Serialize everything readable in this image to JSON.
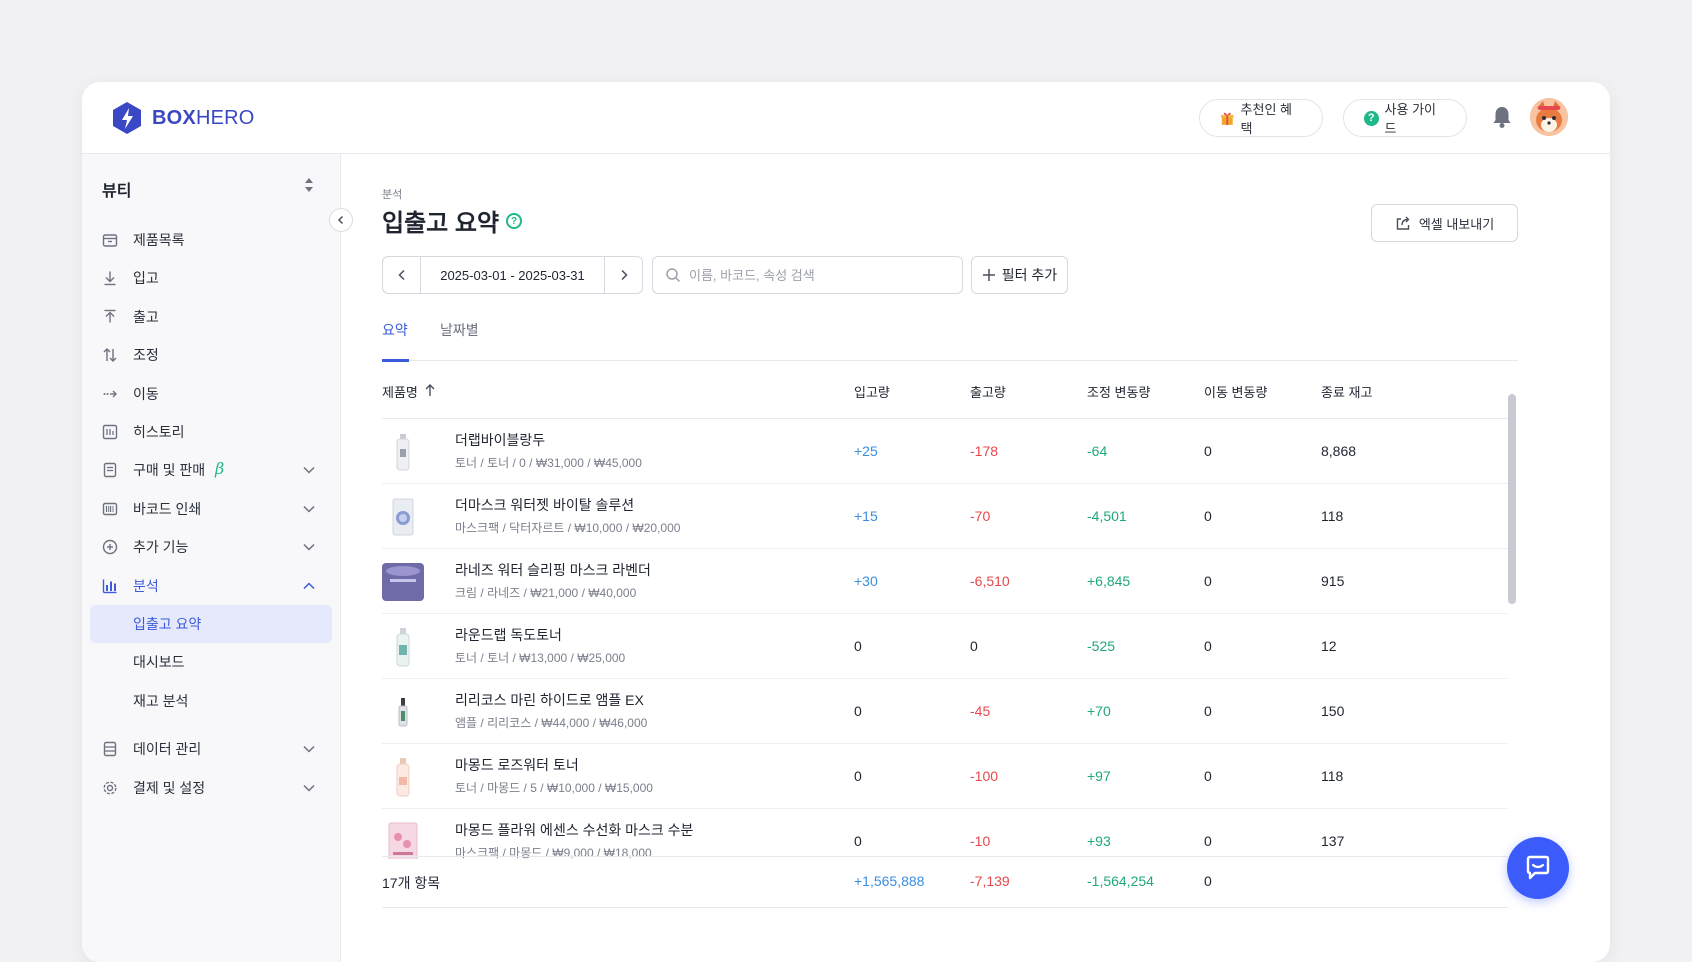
{
  "brand": {
    "logo_bold": "BOX",
    "logo_light": "HERO",
    "accent": "#3b48c6"
  },
  "header": {
    "referral_label": "추천인 혜택",
    "guide_label": "사용 가이드"
  },
  "sidebar": {
    "workspace": "뷰티",
    "items": [
      {
        "label": "제품목록",
        "icon": "box-icon"
      },
      {
        "label": "입고",
        "icon": "arrow-down-icon"
      },
      {
        "label": "출고",
        "icon": "arrow-up-icon"
      },
      {
        "label": "조정",
        "icon": "swap-icon"
      },
      {
        "label": "이동",
        "icon": "move-icon"
      },
      {
        "label": "히스토리",
        "icon": "history-icon"
      },
      {
        "label": "구매 및 판매",
        "icon": "document-icon",
        "badge": "β"
      },
      {
        "label": "바코드 인쇄",
        "icon": "barcode-icon"
      },
      {
        "label": "추가 기능",
        "icon": "plus-circle-icon"
      },
      {
        "label": "분석",
        "icon": "chart-icon"
      },
      {
        "label": "데이터 관리",
        "icon": "database-icon"
      },
      {
        "label": "결제 및 설정",
        "icon": "gear-icon"
      }
    ],
    "sub_items": [
      "입출고 요약",
      "대시보드",
      "재고 분석"
    ]
  },
  "main": {
    "breadcrumb": "분석",
    "title": "입출고 요약",
    "export_label": "엑셀 내보내기",
    "date_range": "2025-03-01 - 2025-03-31",
    "search_placeholder": "이름, 바코드, 속성 검색",
    "filter_label": "필터 추가",
    "tabs": [
      "요약",
      "날짜별"
    ],
    "columns": [
      "제품명",
      "입고량",
      "출고량",
      "조정 변동량",
      "이동 변동량",
      "종료 재고"
    ],
    "rows": [
      {
        "name": "더랩바이블랑두",
        "meta": "토너 / 토너 / 0 / ₩31,000 / ₩45,000",
        "in": "+25",
        "out": "-178",
        "adj": "-64",
        "move": "0",
        "end": "8,868"
      },
      {
        "name": "더마스크 워터젯 바이탈 솔루션",
        "meta": "마스크팩 / 닥터자르트 / ₩10,000 / ₩20,000",
        "in": "+15",
        "out": "-70",
        "adj": "-4,501",
        "move": "0",
        "end": "118"
      },
      {
        "name": "라네즈 워터 슬리핑 마스크 라벤더",
        "meta": "크림 / 라네즈 / ₩21,000 / ₩40,000",
        "in": "+30",
        "out": "-6,510",
        "adj": "+6,845",
        "move": "0",
        "end": "915"
      },
      {
        "name": "라운드랩 독도토너",
        "meta": "토너 / 토너 / ₩13,000 / ₩25,000",
        "in": "0",
        "out": "0",
        "adj": "-525",
        "move": "0",
        "end": "12"
      },
      {
        "name": "리리코스 마린 하이드로 앰플 EX",
        "meta": "앰플 / 리리코스 / ₩44,000 / ₩46,000",
        "in": "0",
        "out": "-45",
        "adj": "+70",
        "move": "0",
        "end": "150"
      },
      {
        "name": "마몽드 로즈워터 토너",
        "meta": "토너 / 마몽드 / 5 / ₩10,000 / ₩15,000",
        "in": "0",
        "out": "-100",
        "adj": "+97",
        "move": "0",
        "end": "118"
      },
      {
        "name": "마몽드 플라워 에센스 수선화 마스크 수분",
        "meta": "마스크팩 / 마몽드 / ₩9,000 / ₩18,000",
        "in": "0",
        "out": "-10",
        "adj": "+93",
        "move": "0",
        "end": "137"
      }
    ],
    "footer": {
      "count": "17개 항목",
      "in": "+1,565,888",
      "out": "-7,139",
      "adj": "-1,564,254",
      "move": "0"
    }
  }
}
